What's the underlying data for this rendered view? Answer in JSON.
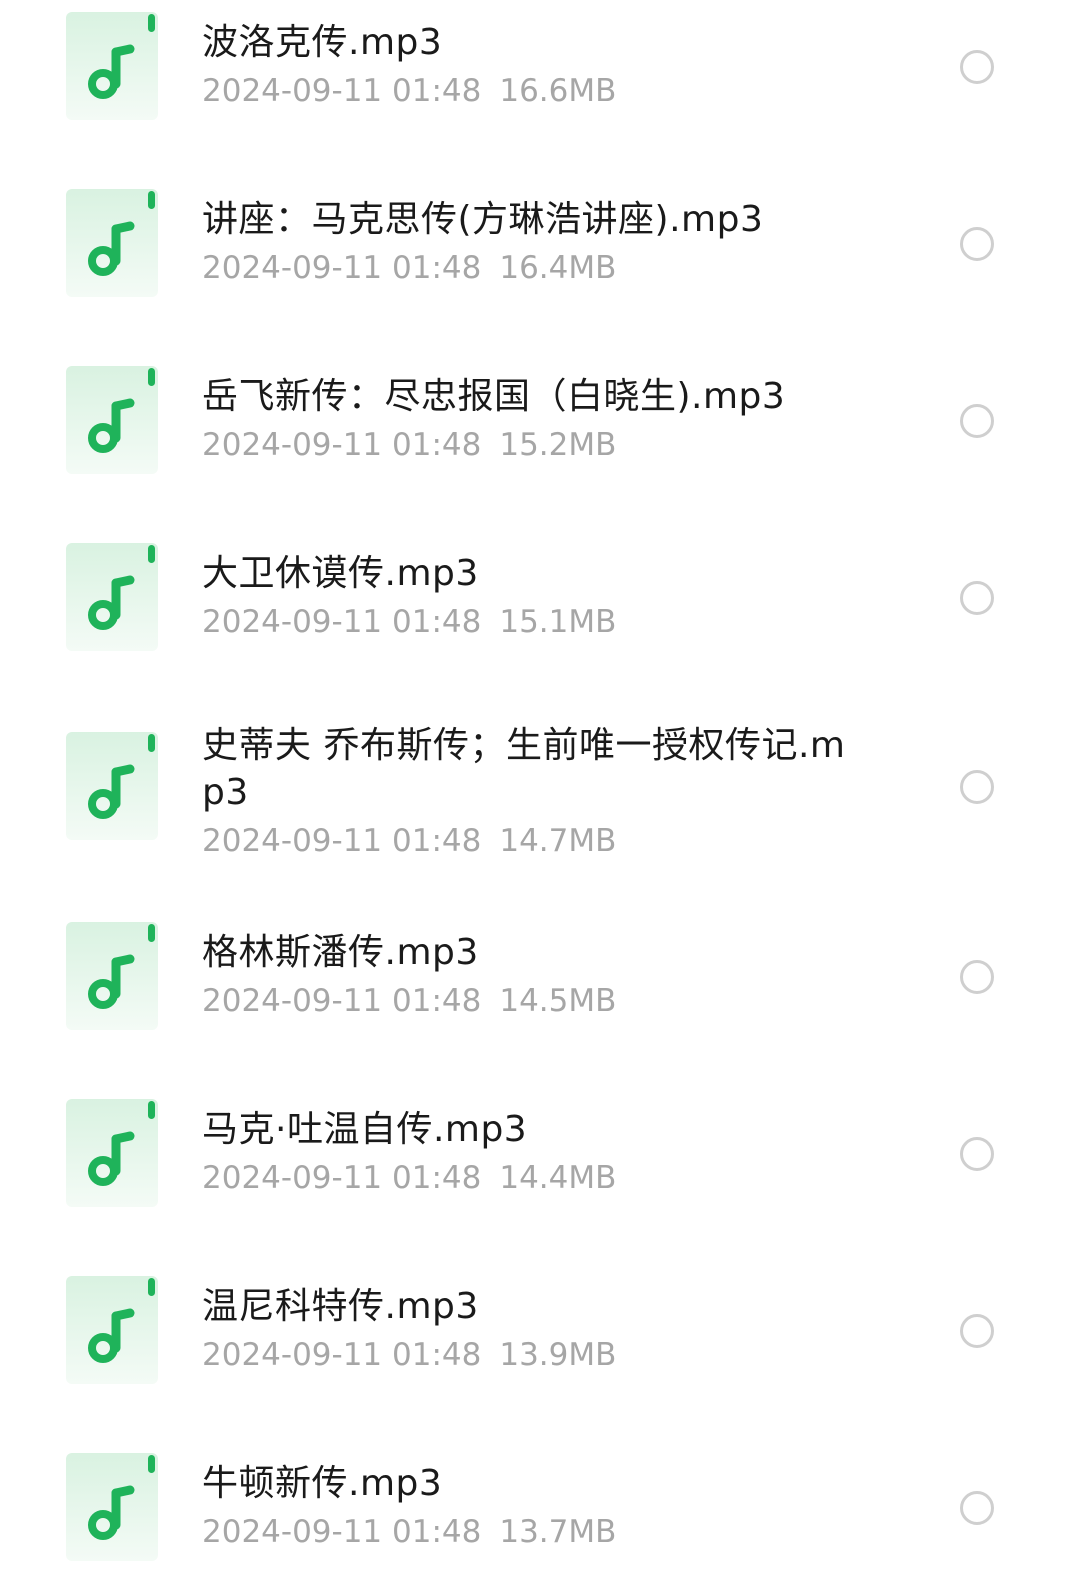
{
  "icon_colors": {
    "accent": "#1fb35a",
    "tile_top": "#d9f2e1",
    "tile_bottom": "#f4fbf6"
  },
  "files": [
    {
      "name": "波洛克传.mp3",
      "date": "2024-09-11 01:48",
      "size": "16.6MB"
    },
    {
      "name": "讲座：马克思传(方琳浩讲座).mp3",
      "date": "2024-09-11 01:48",
      "size": "16.4MB"
    },
    {
      "name": "岳飞新传：尽忠报国（白晓生).mp3",
      "date": "2024-09-11 01:48",
      "size": "15.2MB"
    },
    {
      "name": "大卫休谟传.mp3",
      "date": "2024-09-11 01:48",
      "size": "15.1MB"
    },
    {
      "name": "史蒂夫 乔布斯传；生前唯一授权传记.mp3",
      "date": "2024-09-11 01:48",
      "size": "14.7MB"
    },
    {
      "name": "格林斯潘传.mp3",
      "date": "2024-09-11 01:48",
      "size": "14.5MB"
    },
    {
      "name": "马克·吐温自传.mp3",
      "date": "2024-09-11 01:48",
      "size": "14.4MB"
    },
    {
      "name": "温尼科特传.mp3",
      "date": "2024-09-11 01:48",
      "size": "13.9MB"
    },
    {
      "name": "牛顿新传.mp3",
      "date": "2024-09-11 01:48",
      "size": "13.7MB"
    }
  ]
}
